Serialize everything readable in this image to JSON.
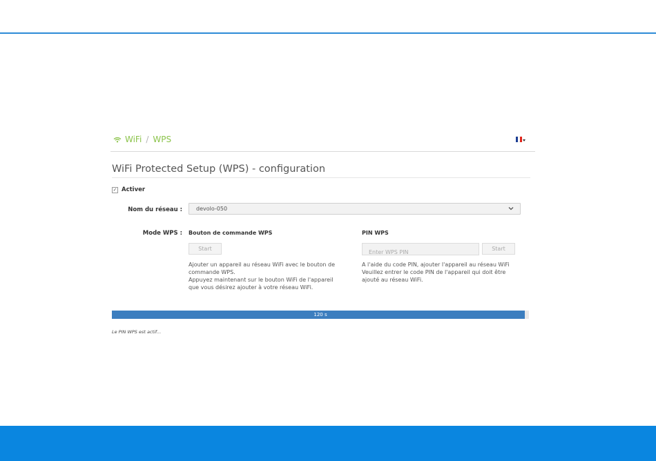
{
  "breadcrumb": {
    "section": "WiFi",
    "separator": "/",
    "page": "WPS"
  },
  "language": {
    "flag_colors": [
      "#1c3f94",
      "#ffffff",
      "#e1251b"
    ]
  },
  "title": "WiFi Protected Setup (WPS) - configuration",
  "activate": {
    "label": "Activer",
    "checked": true
  },
  "network": {
    "label": "Nom du réseau :",
    "value": "devolo-050"
  },
  "mode": {
    "label": "Mode WPS :",
    "push_button": {
      "heading": "Bouton de commande WPS",
      "button": "Start",
      "description": [
        "Ajouter un appareil au réseau WiFi avec le bouton de",
        "commande WPS.",
        "Appuyez maintenant sur le bouton WiFi de l'appareil",
        "que vous désirez ajouter à votre réseau WiFi."
      ]
    },
    "pin": {
      "heading": "PIN WPS",
      "placeholder": "Enter WPS PIN",
      "button": "Start",
      "description": [
        "A l'aide du code PIN, ajouter l'appareil au réseau WiFi",
        "Veuillez entrer le code PIN de l'appareil qui doit être",
        "ajouté au réseau WiFi."
      ]
    }
  },
  "progress": {
    "label": "120 s",
    "fraction": 0.99
  },
  "status_text": "Le PIN WPS est actif...",
  "colors": {
    "accent_green": "#8bc34a",
    "progress_blue": "#3c7ebf",
    "footer_blue": "#0a86e0"
  }
}
